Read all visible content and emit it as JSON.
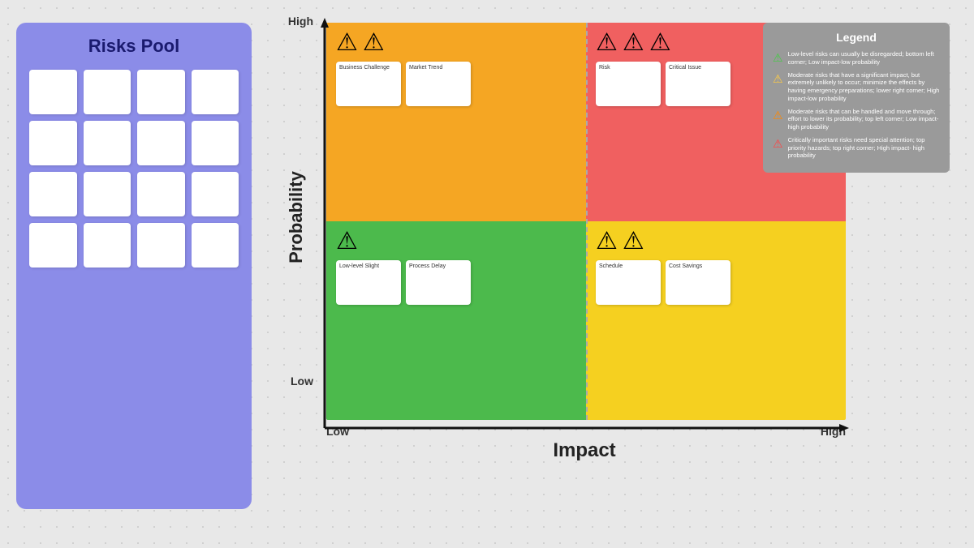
{
  "risksPool": {
    "title": "Risks Pool",
    "cards": [
      {
        "id": 1,
        "text": ""
      },
      {
        "id": 2,
        "text": ""
      },
      {
        "id": 3,
        "text": ""
      },
      {
        "id": 4,
        "text": ""
      },
      {
        "id": 5,
        "text": ""
      },
      {
        "id": 6,
        "text": ""
      },
      {
        "id": 7,
        "text": ""
      },
      {
        "id": 8,
        "text": ""
      },
      {
        "id": 9,
        "text": ""
      },
      {
        "id": 10,
        "text": ""
      },
      {
        "id": 11,
        "text": ""
      },
      {
        "id": 12,
        "text": ""
      },
      {
        "id": 13,
        "text": ""
      },
      {
        "id": 14,
        "text": ""
      },
      {
        "id": 15,
        "text": ""
      },
      {
        "id": 16,
        "text": ""
      }
    ]
  },
  "chart": {
    "yAxisLabel": "Probability",
    "xAxisLabel": "Impact",
    "yHigh": "High",
    "yLow": "Low",
    "xLow": "Low",
    "xHigh": "High"
  },
  "quadrants": {
    "topLeft": {
      "icons": [
        "⚠",
        "⚠"
      ],
      "cards": [
        {
          "id": 1,
          "text": "Business Challenge"
        },
        {
          "id": 2,
          "text": "Market Trend"
        }
      ]
    },
    "topRight": {
      "icons": [
        "⚠",
        "⚠",
        "⚠"
      ],
      "cards": [
        {
          "id": 3,
          "text": "Risk"
        },
        {
          "id": 4,
          "text": "Critical Issue"
        }
      ]
    },
    "botLeft": {
      "icons": [
        "⚠"
      ],
      "cards": [
        {
          "id": 5,
          "text": "Low-level Slight"
        },
        {
          "id": 6,
          "text": "Process Delay"
        }
      ]
    },
    "botRight": {
      "icons": [
        "⚠",
        "⚠"
      ],
      "cards": [
        {
          "id": 7,
          "text": "Schedule"
        },
        {
          "id": 8,
          "text": "Cost Savings"
        }
      ]
    }
  },
  "legend": {
    "title": "Legend",
    "items": [
      {
        "iconColor": "green",
        "text": "Low-level risks can usually be disregarded; bottom left corner; Low impact-low probability"
      },
      {
        "iconColor": "yellow",
        "text": "Moderate risks that have a significant impact, but extremely unlikely to occur; minimize the effects by having emergency preparations; lower right corner; High impact-low probability"
      },
      {
        "iconColor": "orange",
        "text": "Moderate risks that can be handled and move through; effort to lower its probability; top left corner; Low impact-high probability"
      },
      {
        "iconColor": "red",
        "text": "Critically important risks need special attention; top priority hazards; top right corner; High impact- high probability"
      }
    ]
  }
}
